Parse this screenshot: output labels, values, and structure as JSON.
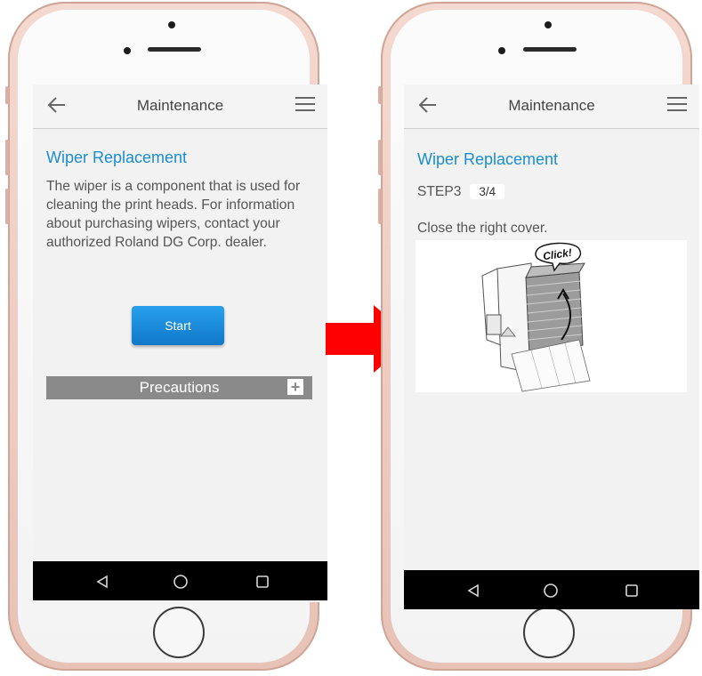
{
  "left_screen": {
    "header": {
      "title": "Maintenance"
    },
    "heading": "Wiper Replacement",
    "description": "The wiper is a component that is used for cleaning the print heads. For information about purchasing wipers, contact your authorized Roland DG Corp. dealer.",
    "start_label": "Start",
    "precautions_label": "Precautions",
    "precautions_toggle": "+"
  },
  "right_screen": {
    "header": {
      "title": "Maintenance"
    },
    "heading": "Wiper Replacement",
    "step_label": "STEP3",
    "step_progress": "3/4",
    "instruction": "Close the right cover.",
    "illustration_callout": "Click!"
  },
  "icons": {
    "back": "back-arrow-icon",
    "menu": "hamburger-menu-icon",
    "nav_back": "triangle-back-icon",
    "nav_home": "circle-home-icon",
    "nav_recents": "square-recents-icon",
    "transition": "red-right-arrow"
  },
  "colors": {
    "heading": "#1a8dd0",
    "start_button": "#1a8ad9",
    "precautions_bar": "#8a8a8a",
    "arrow": "#ff0000",
    "phone_frame": "#e9c6bb"
  }
}
